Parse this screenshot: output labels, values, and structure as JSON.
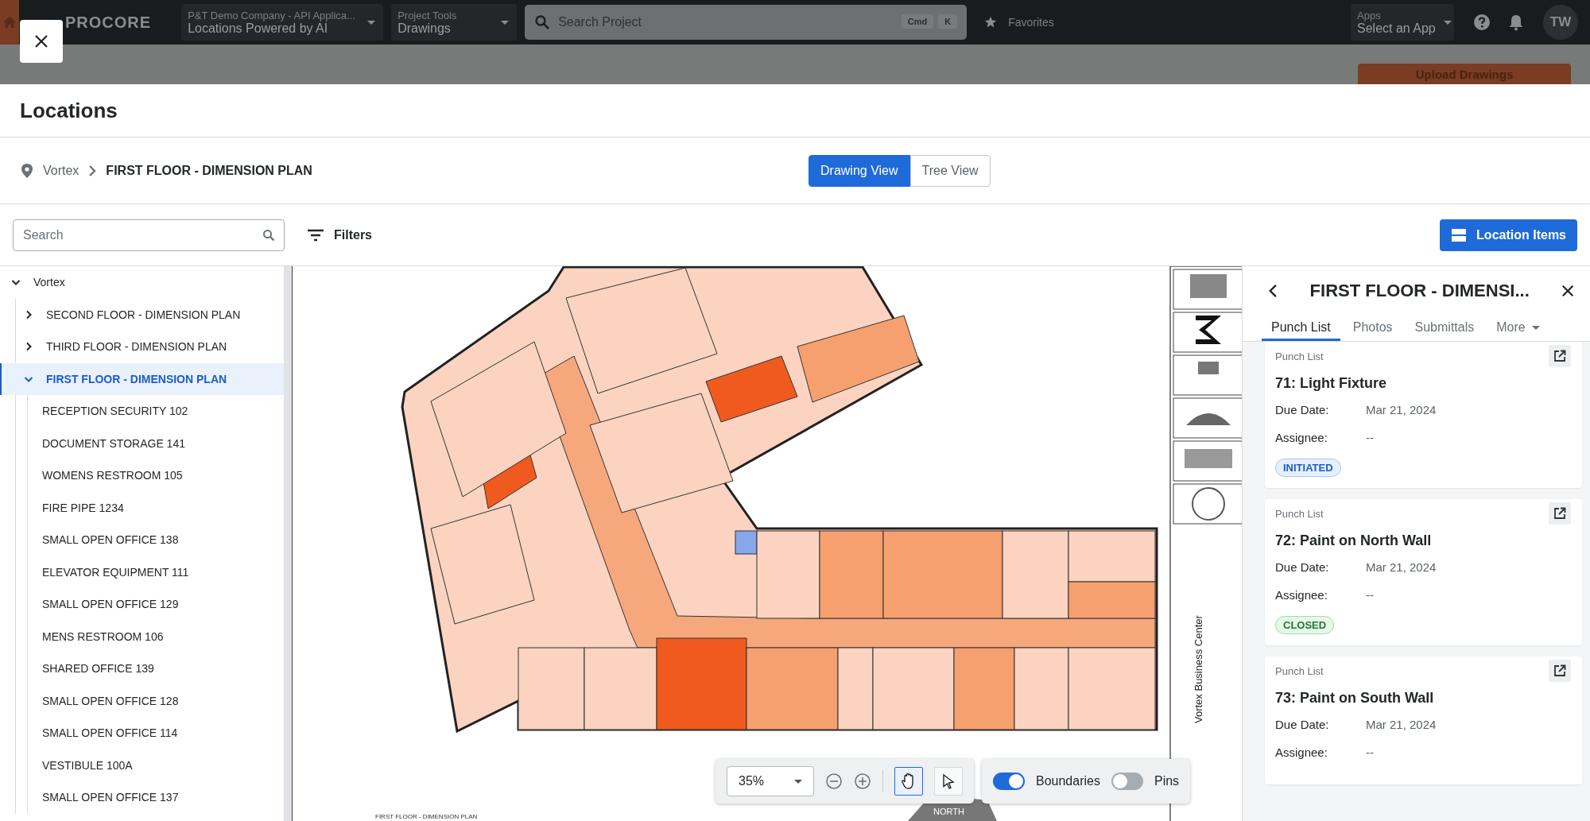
{
  "app_header": {
    "brand": "PROCORE",
    "project_picker": {
      "label": "P&T Demo Company - API Applica...",
      "value": "Locations Powered by AI"
    },
    "tool_picker": {
      "label": "Project Tools",
      "value": "Drawings"
    },
    "search": {
      "placeholder": "Search Project",
      "keys": [
        "Cmd",
        "K"
      ]
    },
    "favorites": "Favorites",
    "apps_picker": {
      "label": "Apps",
      "value": "Select an App"
    },
    "avatar": "TW",
    "upload_button": "Upload Drawings"
  },
  "modal": {
    "title": "Locations",
    "breadcrumb": [
      "Vortex",
      "FIRST FLOOR - DIMENSION PLAN"
    ],
    "views": [
      {
        "label": "Drawing View",
        "selected": true
      },
      {
        "label": "Tree View",
        "selected": false
      }
    ],
    "search": {
      "placeholder": "Search"
    },
    "filters": "Filters",
    "location_items_button": "Location Items",
    "tree": [
      {
        "label": "Vortex",
        "expanded": true,
        "selected": false,
        "children": [
          {
            "label": "SECOND FLOOR - DIMENSION PLAN",
            "expanded": false,
            "selected": false
          },
          {
            "label": "THIRD FLOOR - DIMENSION PLAN",
            "expanded": false,
            "selected": false
          },
          {
            "label": "FIRST FLOOR - DIMENSION PLAN",
            "expanded": true,
            "selected": true,
            "children": [
              {
                "label": "RECEPTION SECURITY 102",
                "selected": false
              },
              {
                "label": "DOCUMENT STORAGE 141",
                "selected": false
              },
              {
                "label": "WOMENS RESTROOM 105",
                "selected": false
              },
              {
                "label": "FIRE PIPE 1234",
                "selected": false
              },
              {
                "label": "SMALL OPEN OFFICE 138",
                "selected": false
              },
              {
                "label": "ELEVATOR EQUIPMENT 111",
                "selected": false
              },
              {
                "label": "SMALL OPEN OFFICE 129",
                "selected": false
              },
              {
                "label": "MENS RESTROOM 106",
                "selected": false
              },
              {
                "label": "SHARED OFFICE 139",
                "selected": false
              },
              {
                "label": "SMALL OPEN OFFICE 128",
                "selected": false
              },
              {
                "label": "SMALL OPEN OFFICE 114",
                "selected": false
              },
              {
                "label": "VESTIBULE 100A",
                "selected": false
              },
              {
                "label": "SMALL OPEN OFFICE 137",
                "selected": false
              }
            ]
          }
        ]
      }
    ],
    "drawing": {
      "project_name": "Vortex Business Center",
      "plan_title": "FIRST FLOOR - DIMENSION PLAN",
      "north_label": "NORTH"
    },
    "toolbar": {
      "zoom": "35%",
      "tools": [
        {
          "kind": "hand",
          "selected": true
        },
        {
          "kind": "pointer",
          "selected": false
        }
      ],
      "toggles": [
        {
          "label": "Boundaries",
          "on": true
        },
        {
          "label": "Pins",
          "on": false
        }
      ]
    },
    "panel": {
      "title": "FIRST FLOOR - DIMENSI...",
      "tabs": [
        {
          "label": "Punch List",
          "selected": true
        },
        {
          "label": "Photos",
          "selected": false
        },
        {
          "label": "Submittals",
          "selected": false
        },
        {
          "label": "More",
          "selected": false
        }
      ],
      "cards": [
        {
          "type": "Punch List",
          "title": "71: Light Fixture",
          "fields": [
            {
              "label": "Due Date:",
              "value": "Mar 21, 2024"
            },
            {
              "label": "Assignee:",
              "value": "--"
            }
          ],
          "status": {
            "kind": "initiated",
            "label": "INITIATED"
          }
        },
        {
          "type": "Punch List",
          "title": "72: Paint on North Wall",
          "fields": [
            {
              "label": "Due Date:",
              "value": "Mar 21, 2024"
            },
            {
              "label": "Assignee:",
              "value": "--"
            }
          ],
          "status": {
            "kind": "closed",
            "label": "CLOSED"
          }
        },
        {
          "type": "Punch List",
          "title": "73: Paint on South Wall",
          "fields": [
            {
              "label": "Due Date:",
              "value": "Mar 21, 2024"
            },
            {
              "label": "Assignee:",
              "value": "--"
            }
          ]
        }
      ]
    }
  }
}
